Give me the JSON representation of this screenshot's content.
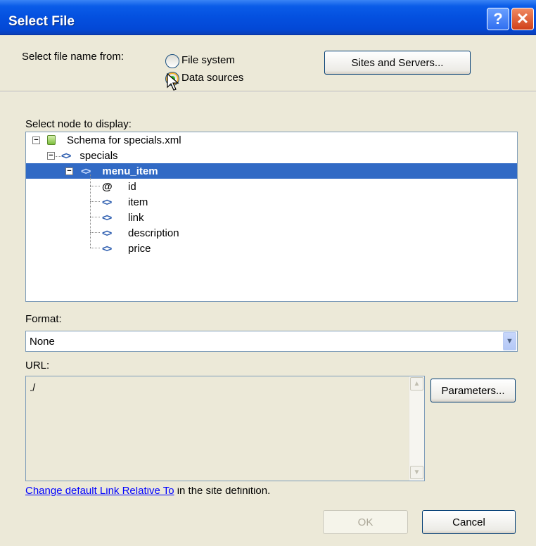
{
  "window": {
    "title": "Select File",
    "help_glyph": "?",
    "close_glyph": "✕"
  },
  "source": {
    "label": "Select file name from:",
    "options": [
      "File system",
      "Data sources"
    ],
    "selected": "Data sources",
    "sites_button": "Sites and Servers..."
  },
  "tree": {
    "label": "Select node to display:",
    "root": "Schema for specials.xml",
    "child": "specials",
    "selected": "menu_item",
    "leaves": [
      {
        "icon": "attribute-icon",
        "label": "id"
      },
      {
        "icon": "element-icon",
        "label": "item"
      },
      {
        "icon": "element-icon",
        "label": "link"
      },
      {
        "icon": "element-icon",
        "label": "description"
      },
      {
        "icon": "element-icon",
        "label": "price"
      }
    ]
  },
  "format": {
    "label": "Format:",
    "value": "None"
  },
  "url": {
    "label": "URL:",
    "value": "./",
    "parameters_button": "Parameters..."
  },
  "footer": {
    "link_text": "Change default Link Relative To",
    "link_suffix": " in the site definition.",
    "ok": "OK",
    "cancel": "Cancel"
  },
  "colors": {
    "title_bar": "#0450df",
    "selection": "#316ac5",
    "dialog_bg": "#ece9d8"
  }
}
